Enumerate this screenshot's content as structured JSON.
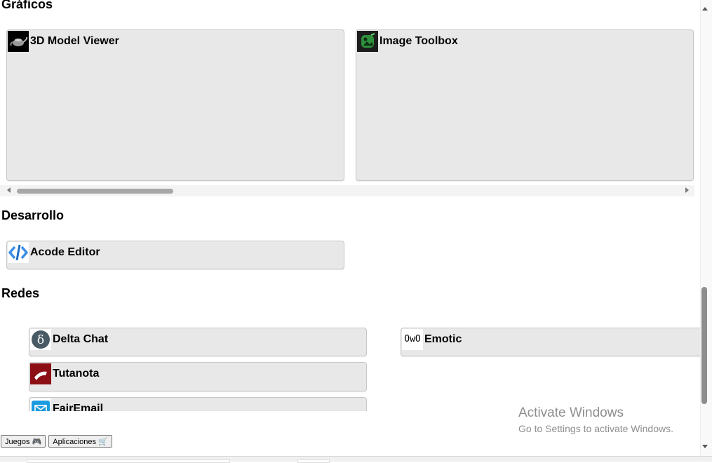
{
  "sections": {
    "graficos": {
      "title": "Gráficos",
      "apps": [
        {
          "name": "3D Model Viewer",
          "icon": "teapot-icon"
        },
        {
          "name": "Image Toolbox",
          "icon": "image-toolbox-icon"
        }
      ]
    },
    "desarrollo": {
      "title": "Desarrollo",
      "apps": [
        {
          "name": "Acode Editor",
          "icon": "code-brackets-icon"
        }
      ]
    },
    "redes": {
      "title": "Redes",
      "apps": [
        {
          "name": "Delta Chat",
          "icon": "delta-icon"
        },
        {
          "name": "Emotic",
          "icon": "emotic-icon",
          "icon_text": "OwO"
        },
        {
          "name": "Tutanota",
          "icon": "tutanota-icon"
        },
        {
          "name": "FairEmail",
          "icon": "envelope-icon"
        }
      ]
    }
  },
  "nav_buttons": {
    "juegos": "Juegos 🎮",
    "aplicaciones": "Aplicaciones 🛒"
  },
  "watermark": {
    "title": "Activate Windows",
    "subtitle": "Go to Settings to activate Windows."
  },
  "colors": {
    "card_bg": "#e8e8e8",
    "card_border": "#c7c7c7",
    "page_bg": "#ffffff"
  }
}
